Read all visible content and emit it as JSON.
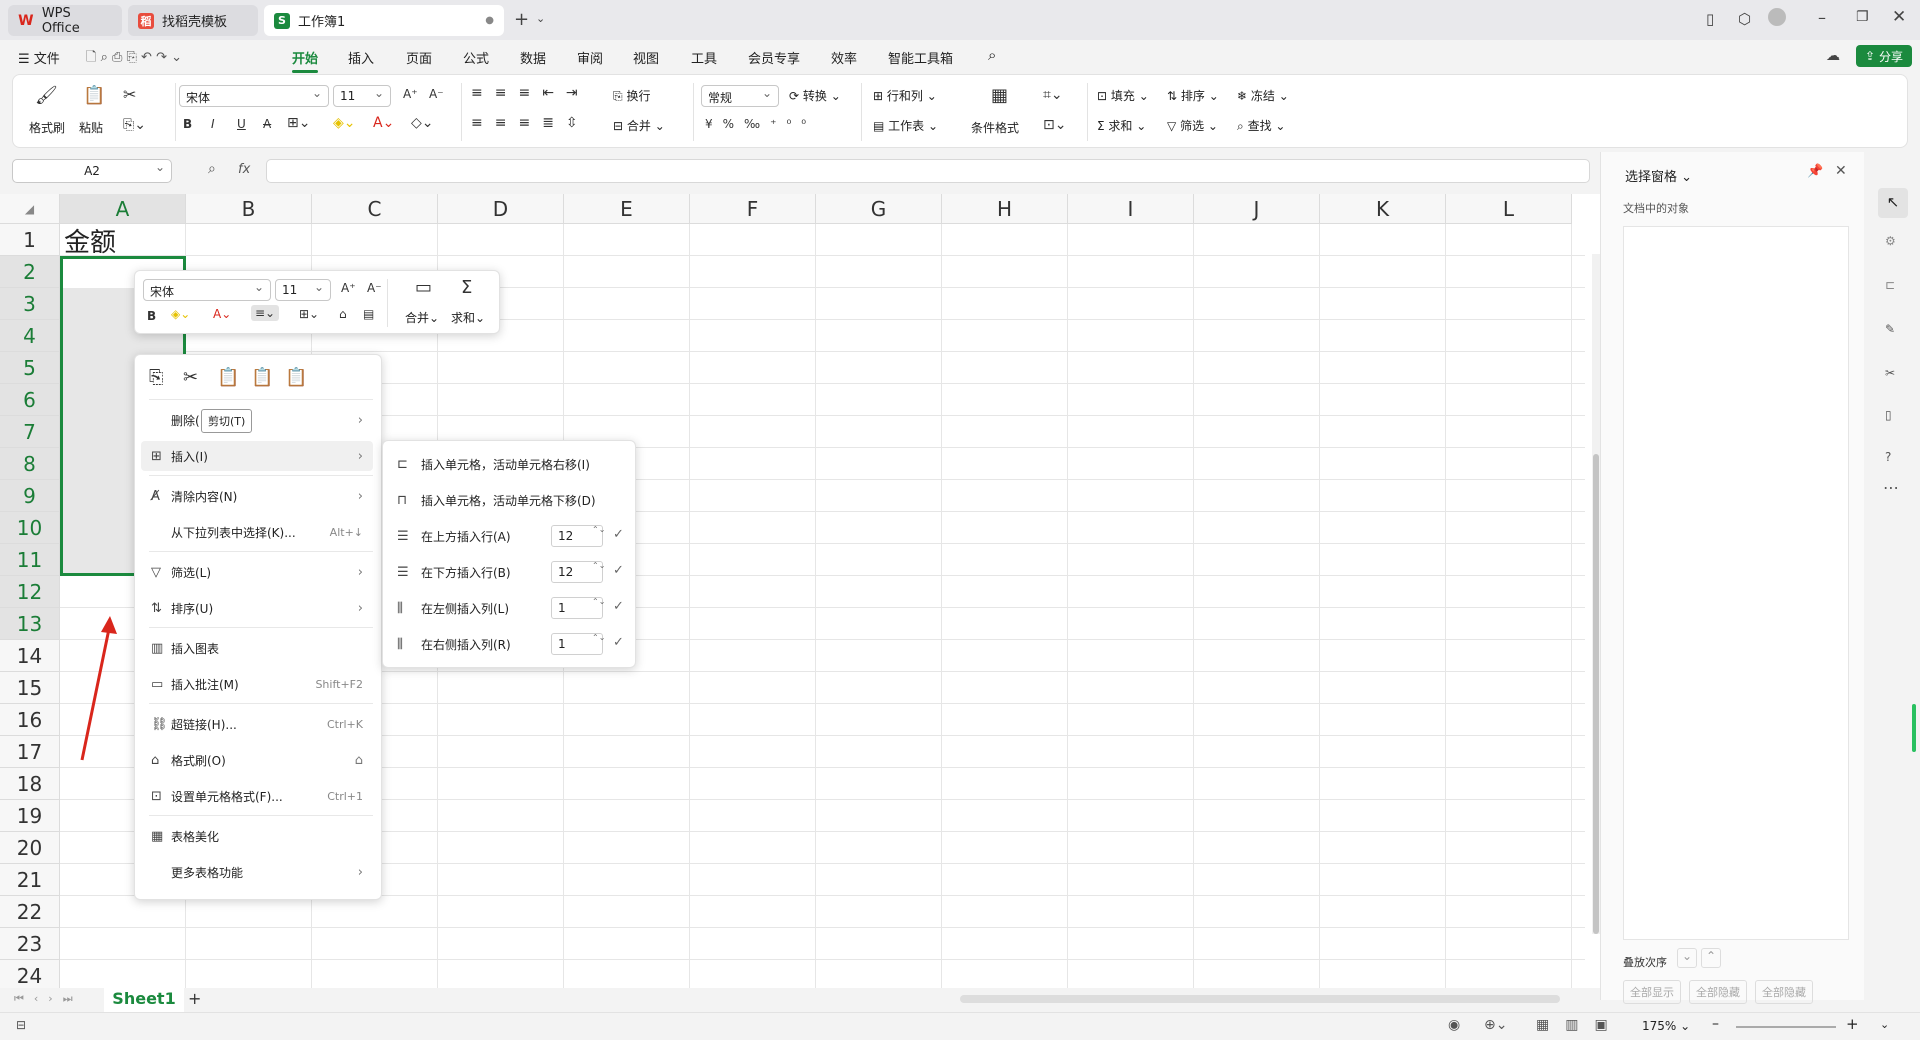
{
  "titlebar": {
    "tabs": [
      {
        "label": "WPS Office"
      },
      {
        "label": "找稻壳模板"
      },
      {
        "label": "工作簿1"
      }
    ]
  },
  "menu": {
    "file": "文件",
    "items": [
      "开始",
      "插入",
      "页面",
      "公式",
      "数据",
      "审阅",
      "视图",
      "工具",
      "会员专享",
      "效率",
      "智能工具箱"
    ],
    "share": "分享"
  },
  "ribbon": {
    "format_painter": "格式刷",
    "paste": "粘贴",
    "font": "宋体",
    "size": "11",
    "wrap": "换行",
    "merge": "合并",
    "number_format": "常规",
    "convert": "转换",
    "rowcol": "行和列",
    "worksheet": "工作表",
    "cond_format": "条件格式",
    "fill": "填充",
    "sort": "排序",
    "freeze": "冻结",
    "sum": "求和",
    "filter": "筛选",
    "find": "查找"
  },
  "formula": {
    "namebox": "A2",
    "fx": "fx"
  },
  "grid": {
    "columns": [
      "A",
      "B",
      "C",
      "D",
      "E",
      "F",
      "G",
      "H",
      "I",
      "J",
      "K",
      "L"
    ],
    "rows": [
      "1",
      "2",
      "3",
      "4",
      "5",
      "6",
      "7",
      "8",
      "9",
      "10",
      "11",
      "12",
      "13",
      "14",
      "15",
      "16",
      "17",
      "18",
      "19",
      "20",
      "21",
      "22",
      "23",
      "24"
    ],
    "a1": "金额"
  },
  "mini": {
    "font": "宋体",
    "size": "11",
    "merge": "合并",
    "sum": "求和"
  },
  "context": {
    "tooltip": "剪切(T)",
    "items": [
      {
        "label": "删除(",
        "shortcut": ""
      },
      {
        "label": "插入(I)",
        "shortcut": ""
      },
      {
        "label": "清除内容(N)",
        "shortcut": ""
      },
      {
        "label": "从下拉列表中选择(K)...",
        "shortcut": "Alt+↓"
      },
      {
        "label": "筛选(L)",
        "shortcut": ""
      },
      {
        "label": "排序(U)",
        "shortcut": ""
      },
      {
        "label": "插入图表",
        "shortcut": ""
      },
      {
        "label": "插入批注(M)",
        "shortcut": "Shift+F2"
      },
      {
        "label": "超链接(H)...",
        "shortcut": "Ctrl+K"
      },
      {
        "label": "格式刷(O)",
        "shortcut": ""
      },
      {
        "label": "设置单元格格式(F)...",
        "shortcut": "Ctrl+1"
      },
      {
        "label": "表格美化",
        "shortcut": ""
      },
      {
        "label": "更多表格功能",
        "shortcut": ""
      }
    ]
  },
  "submenu": {
    "items": [
      {
        "label": "插入单元格，活动单元格右移(I)"
      },
      {
        "label": "插入单元格，活动单元格下移(D)"
      },
      {
        "label": "在上方插入行(A)",
        "value": "12"
      },
      {
        "label": "在下方插入行(B)",
        "value": "12"
      },
      {
        "label": "在左侧插入列(L)",
        "value": "1"
      },
      {
        "label": "在右侧插入列(R)",
        "value": "1"
      }
    ]
  },
  "panel": {
    "title": "选择窗格",
    "subtitle": "文档中的对象",
    "order": "叠放次序",
    "show_all": "全部显示",
    "hide_all": "全部隐藏",
    "hide_all2": "全部隐藏"
  },
  "sheet": {
    "tab": "Sheet1"
  },
  "status": {
    "zoom": "175%"
  },
  "colors": {
    "accent": "#1b8a3e",
    "arrow": "#d9261c"
  }
}
